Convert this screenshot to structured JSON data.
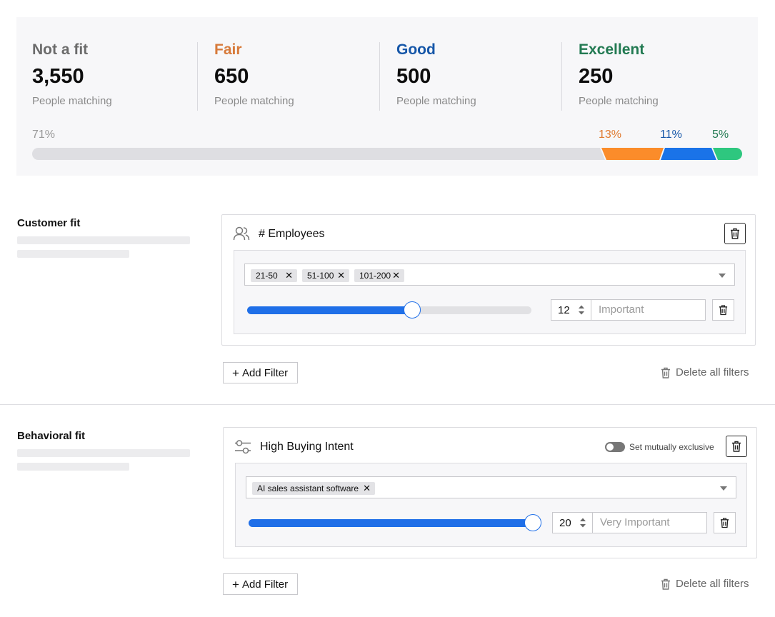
{
  "summary": {
    "tiers": [
      {
        "name": "Not a fit",
        "count": "3,550",
        "sub": "People matching",
        "color": "#6b6b6b"
      },
      {
        "name": "Fair",
        "count": "650",
        "sub": "People matching",
        "color": "#d77a3a"
      },
      {
        "name": "Good",
        "count": "500",
        "sub": "People matching",
        "color": "#1556a8"
      },
      {
        "name": "Excellent",
        "count": "250",
        "sub": "People matching",
        "color": "#227a52"
      }
    ],
    "distribution": [
      {
        "label": "71%",
        "color": "#dedee2",
        "text_color": "#999999"
      },
      {
        "label": "13%",
        "color": "#fb8c2a",
        "text_color": "#e07a2f"
      },
      {
        "label": "11%",
        "color": "#1a73e8",
        "text_color": "#1556a8"
      },
      {
        "label": "5%",
        "color": "#2ec77f",
        "text_color": "#227a52"
      }
    ]
  },
  "customer_fit": {
    "title": "Customer fit",
    "card": {
      "title": "# Employees",
      "icon": "people-icon",
      "chips": [
        "21-50",
        "51-100",
        "101-200"
      ],
      "chip_remove": "✕",
      "weight": "12",
      "importance_placeholder": "Important",
      "slider_fraction": 0.58
    },
    "add_filter": "Add Filter",
    "delete_all": "Delete all filters"
  },
  "behavioral_fit": {
    "title": "Behavioral fit",
    "card": {
      "title": "High Buying Intent",
      "icon": "sliders-icon",
      "toggle_label": "Set mutually exclusive",
      "chips": [
        "AI sales assistant software"
      ],
      "chip_remove": "✕",
      "weight": "20",
      "importance_placeholder": "Very Important",
      "slider_fraction": 1.0
    },
    "add_filter": "Add Filter",
    "delete_all": "Delete all filters"
  },
  "icons": {
    "plus": "+",
    "spin": "⬍"
  },
  "accent": "#1f6fe8"
}
